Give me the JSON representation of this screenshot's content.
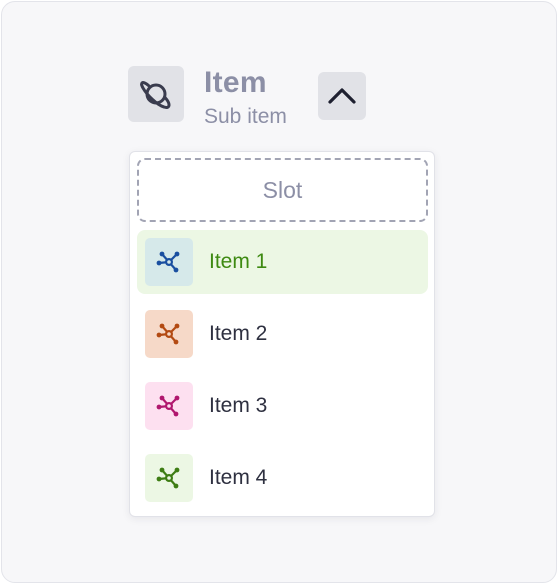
{
  "trigger": {
    "title": "Item",
    "subtitle": "Sub item",
    "icon": "planet-icon",
    "toggle_icon": "chevron-up-icon"
  },
  "menu": {
    "slot_label": "Slot",
    "items": [
      {
        "label": "Item 1",
        "icon": "molecule-icon",
        "icon_bg": "#d6e9ea",
        "icon_color": "#1a4fa0",
        "selected": true
      },
      {
        "label": "Item 2",
        "icon": "molecule-icon",
        "icon_bg": "#f6d9c8",
        "icon_color": "#b34a12",
        "selected": false
      },
      {
        "label": "Item 3",
        "icon": "molecule-icon",
        "icon_bg": "#fde0f0",
        "icon_color": "#b0176e",
        "selected": false
      },
      {
        "label": "Item 4",
        "icon": "molecule-icon",
        "icon_bg": "#ecf7e4",
        "icon_color": "#3e7d14",
        "selected": false
      }
    ],
    "selected_bg": "#ecf7e4",
    "selected_text": "#3e8a12"
  }
}
